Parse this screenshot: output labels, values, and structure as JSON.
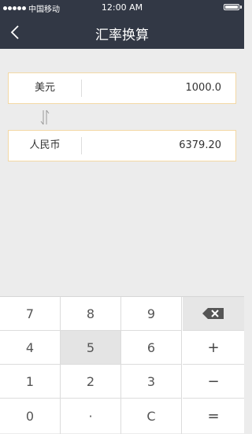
{
  "status_bar": {
    "carrier": "中国移动",
    "time": "12:00 AM"
  },
  "nav": {
    "title": "汇率换算",
    "back_icon": "chevron-left-icon"
  },
  "from_currency": {
    "name": "美元",
    "value": "1000.0"
  },
  "to_currency": {
    "name": "人民币",
    "value": "6379.20"
  },
  "swap_icon": "swap-arrows-icon",
  "colors": {
    "header_bg": "#323845",
    "page_bg": "#ececec",
    "row_border": "#f3d8a4",
    "pressed_key": "#e4e4e4"
  },
  "keypad": {
    "keys": [
      [
        "7",
        "8",
        "9",
        ""
      ],
      [
        "4",
        "5",
        "6",
        "+"
      ],
      [
        "1",
        "2",
        "3",
        "−"
      ],
      [
        "0",
        "·",
        "C",
        "="
      ]
    ],
    "delete_icon": "backspace-icon",
    "pressed_key": "5"
  }
}
